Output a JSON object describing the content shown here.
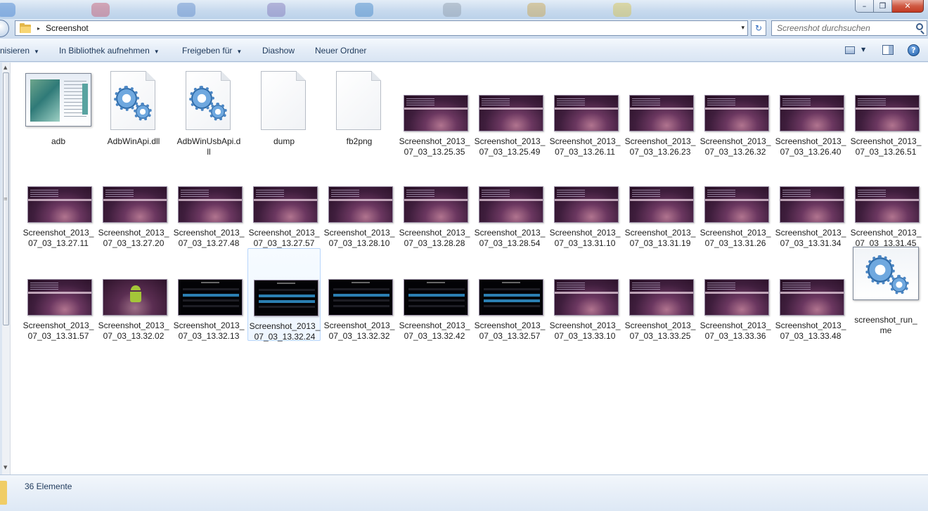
{
  "window": {
    "controls": {
      "minimize": "–",
      "maximize": "❐",
      "close": "✕"
    }
  },
  "address": {
    "breadcrumb_arrow": "▸",
    "path": "Screenshot",
    "dropdown": "▾",
    "refresh": "↻"
  },
  "search": {
    "placeholder": "Screenshot durchsuchen"
  },
  "toolbar": {
    "organize_label": "nisieren",
    "library_label": "In Bibliothek aufnehmen",
    "share_label": "Freigeben für",
    "slideshow_label": "Diashow",
    "new_folder_label": "Neuer Ordner",
    "caret": "▼",
    "help": "?"
  },
  "files": [
    {
      "type": "app-thumb",
      "line1": "adb",
      "line2": ""
    },
    {
      "type": "dll",
      "line1": "AdbWinApi.dll",
      "line2": ""
    },
    {
      "type": "dll",
      "line1": "AdbWinUsbApi.d",
      "line2": "ll"
    },
    {
      "type": "blank",
      "line1": "dump",
      "line2": ""
    },
    {
      "type": "blank",
      "line1": "fb2png",
      "line2": ""
    },
    {
      "type": "purple",
      "line1": "Screenshot_2013_",
      "line2": "07_03_13.25.35"
    },
    {
      "type": "purple",
      "line1": "Screenshot_2013_",
      "line2": "07_03_13.25.49"
    },
    {
      "type": "purple",
      "line1": "Screenshot_2013_",
      "line2": "07_03_13.26.11"
    },
    {
      "type": "purple",
      "line1": "Screenshot_2013_",
      "line2": "07_03_13.26.23"
    },
    {
      "type": "purple",
      "line1": "Screenshot_2013_",
      "line2": "07_03_13.26.32"
    },
    {
      "type": "purple",
      "line1": "Screenshot_2013_",
      "line2": "07_03_13.26.40"
    },
    {
      "type": "purple",
      "line1": "Screenshot_2013_",
      "line2": "07_03_13.26.51"
    },
    {
      "type": "purple",
      "line1": "Screenshot_2013_",
      "line2": "07_03_13.27.11"
    },
    {
      "type": "purple",
      "line1": "Screenshot_2013_",
      "line2": "07_03_13.27.20"
    },
    {
      "type": "purple",
      "line1": "Screenshot_2013_",
      "line2": "07_03_13.27.48"
    },
    {
      "type": "purple",
      "line1": "Screenshot_2013_",
      "line2": "07_03_13.27.57"
    },
    {
      "type": "purple",
      "line1": "Screenshot_2013_",
      "line2": "07_03_13.28.10"
    },
    {
      "type": "purple",
      "line1": "Screenshot_2013_",
      "line2": "07_03_13.28.28"
    },
    {
      "type": "purple",
      "line1": "Screenshot_2013_",
      "line2": "07_03_13.28.54"
    },
    {
      "type": "purple",
      "line1": "Screenshot_2013_",
      "line2": "07_03_13.31.10"
    },
    {
      "type": "purple",
      "line1": "Screenshot_2013_",
      "line2": "07_03_13.31.19"
    },
    {
      "type": "purple",
      "line1": "Screenshot_2013_",
      "line2": "07_03_13.31.26"
    },
    {
      "type": "purple",
      "line1": "Screenshot_2013_",
      "line2": "07_03_13.31.34"
    },
    {
      "type": "purple",
      "line1": "Screenshot_2013_",
      "line2": "07_03_13.31.45"
    },
    {
      "type": "purple",
      "line1": "Screenshot_2013_",
      "line2": "07_03_13.31.57"
    },
    {
      "type": "droid",
      "line1": "Screenshot_2013_",
      "line2": "07_03_13.32.02"
    },
    {
      "type": "dark",
      "line1": "Screenshot_2013_",
      "line2": "07_03_13.32.13"
    },
    {
      "type": "dark",
      "line1": "Screenshot_2013_",
      "line2": "07_03_13.32.24",
      "selected": true
    },
    {
      "type": "dark",
      "line1": "Screenshot_2013_",
      "line2": "07_03_13.32.32"
    },
    {
      "type": "dark",
      "line1": "Screenshot_2013_",
      "line2": "07_03_13.32.42"
    },
    {
      "type": "dark",
      "line1": "Screenshot_2013_",
      "line2": "07_03_13.32.57"
    },
    {
      "type": "purple",
      "line1": "Screenshot_2013_",
      "line2": "07_03_13.33.10"
    },
    {
      "type": "purple",
      "line1": "Screenshot_2013_",
      "line2": "07_03_13.33.25"
    },
    {
      "type": "purple",
      "line1": "Screenshot_2013_",
      "line2": "07_03_13.33.36"
    },
    {
      "type": "purple",
      "line1": "Screenshot_2013_",
      "line2": "07_03_13.33.48"
    },
    {
      "type": "gear-window",
      "line1": "screenshot_run_",
      "line2": "me"
    }
  ],
  "status": {
    "item_count": "36 Elemente"
  },
  "colors": {
    "chrome": "#dfe9f5",
    "link_text": "#1e395b",
    "selection": "#b8d6fb",
    "close_button": "#c43b24"
  }
}
